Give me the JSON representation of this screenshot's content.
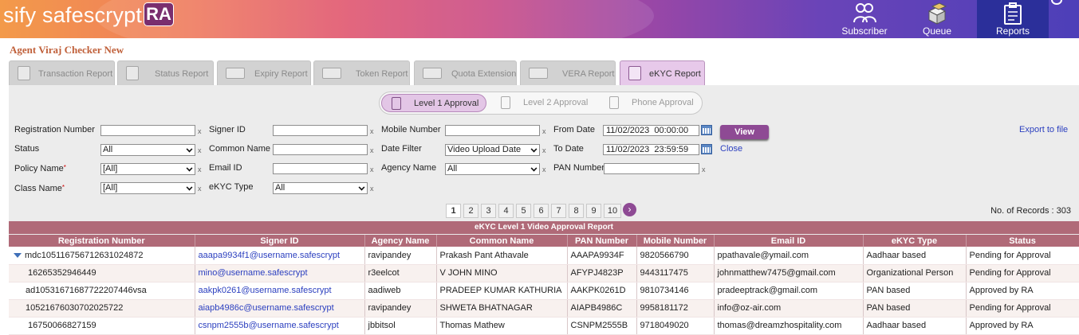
{
  "header": {
    "logo_text": "sify safescrypt",
    "logo_badge": "RA",
    "nav": [
      {
        "label": "Subscriber",
        "icon": "users-icon"
      },
      {
        "label": "Queue",
        "icon": "boxes-icon"
      },
      {
        "label": "Reports",
        "icon": "clipboard-icon"
      }
    ]
  },
  "agent_title": "Agent Viraj Checker New",
  "tabs": [
    {
      "label": "Transaction Report",
      "icon": "document-icon"
    },
    {
      "label": "Status Report",
      "icon": "status-icon"
    },
    {
      "label": "Expiry Report",
      "icon": "calendar-icon"
    },
    {
      "label": "Token Report",
      "icon": "token-icon"
    },
    {
      "label": "Quota Extension",
      "icon": "quota-icon"
    },
    {
      "label": "VERA Report",
      "icon": "vera-icon"
    },
    {
      "label": "eKYC Report",
      "icon": "document-icon",
      "active": true
    }
  ],
  "levels": [
    {
      "label": "Level 1 Approval",
      "active": true
    },
    {
      "label": "Level 2 Approval"
    },
    {
      "label": "Phone Approval"
    }
  ],
  "filters": {
    "registration_number": {
      "label": "Registration Number",
      "value": ""
    },
    "signer_id": {
      "label": "Signer ID",
      "value": ""
    },
    "mobile_number": {
      "label": "Mobile Number",
      "value": ""
    },
    "from_date": {
      "label": "From Date",
      "value": "11/02/2023  00:00:00"
    },
    "status": {
      "label": "Status",
      "value": "All"
    },
    "common_name": {
      "label": "Common Name",
      "value": ""
    },
    "date_filter": {
      "label": "Date Filter",
      "value": "Video Upload Date"
    },
    "to_date": {
      "label": "To Date",
      "value": "11/02/2023  23:59:59"
    },
    "policy_name": {
      "label": "Policy Name",
      "value": "[All]"
    },
    "email_id": {
      "label": "Email ID",
      "value": ""
    },
    "agency_name": {
      "label": "Agency Name",
      "value": "All"
    },
    "pan_number": {
      "label": "PAN Number",
      "value": ""
    },
    "class_name": {
      "label": "Class Name",
      "value": "[All]"
    },
    "ekyc_type": {
      "label": "eKYC Type",
      "value": "All"
    },
    "clear_mark": "x",
    "required_mark": "*"
  },
  "actions": {
    "view": "View",
    "close": "Close",
    "export": "Export to file"
  },
  "pagination": {
    "pages": [
      "1",
      "2",
      "3",
      "4",
      "5",
      "6",
      "7",
      "8",
      "9",
      "10"
    ],
    "current": "1",
    "records_label": "No. of Records : 303"
  },
  "table": {
    "title": "eKYC Level 1 Video Approval Report",
    "columns": [
      "Registration Number",
      "Signer ID",
      "Agency Name",
      "Common Name",
      "PAN Number",
      "Mobile Number",
      "Email ID",
      "eKYC Type",
      "Status"
    ],
    "rows": [
      [
        "mdc105116756712631024872",
        "aaapa9934f1@username.safescrypt",
        "ravipandey",
        "Prakash Pant Athavale",
        "AAAPA9934F",
        "9820566790",
        "ppathavale@ymail.com",
        "Aadhaar based",
        "Pending for Approval"
      ],
      [
        "16265352946449",
        "mino@username.safescrypt",
        "r3eelcot",
        "V JOHN MINO",
        "AFYPJ4823P",
        "9443117475",
        "johnmatthew7475@gmail.com",
        "Organizational Person",
        "Pending for Approval"
      ],
      [
        "ad10531671687722207446vsa",
        "aakpk0261@username.safescrypt",
        "aadiweb",
        "PRADEEP KUMAR KATHURIA",
        "AAKPK0261D",
        "9810734146",
        "pradeeptrack@gmail.com",
        "PAN based",
        "Approved by RA"
      ],
      [
        "10521676030702025722",
        "aiapb4986c@username.safescrypt",
        "ravipandey",
        "SHWETA BHATNAGAR",
        "AIAPB4986C",
        "9958181172",
        "info@oz-air.com",
        "PAN based",
        "Pending for Approval"
      ],
      [
        "16750066827159",
        "csnpm2555b@username.safescrypt",
        "jbbitsol",
        "Thomas Mathew",
        "CSNPM2555B",
        "9718049020",
        "thomas@dreamzhospitality.com",
        "Aadhaar based",
        "Approved by RA"
      ]
    ]
  }
}
